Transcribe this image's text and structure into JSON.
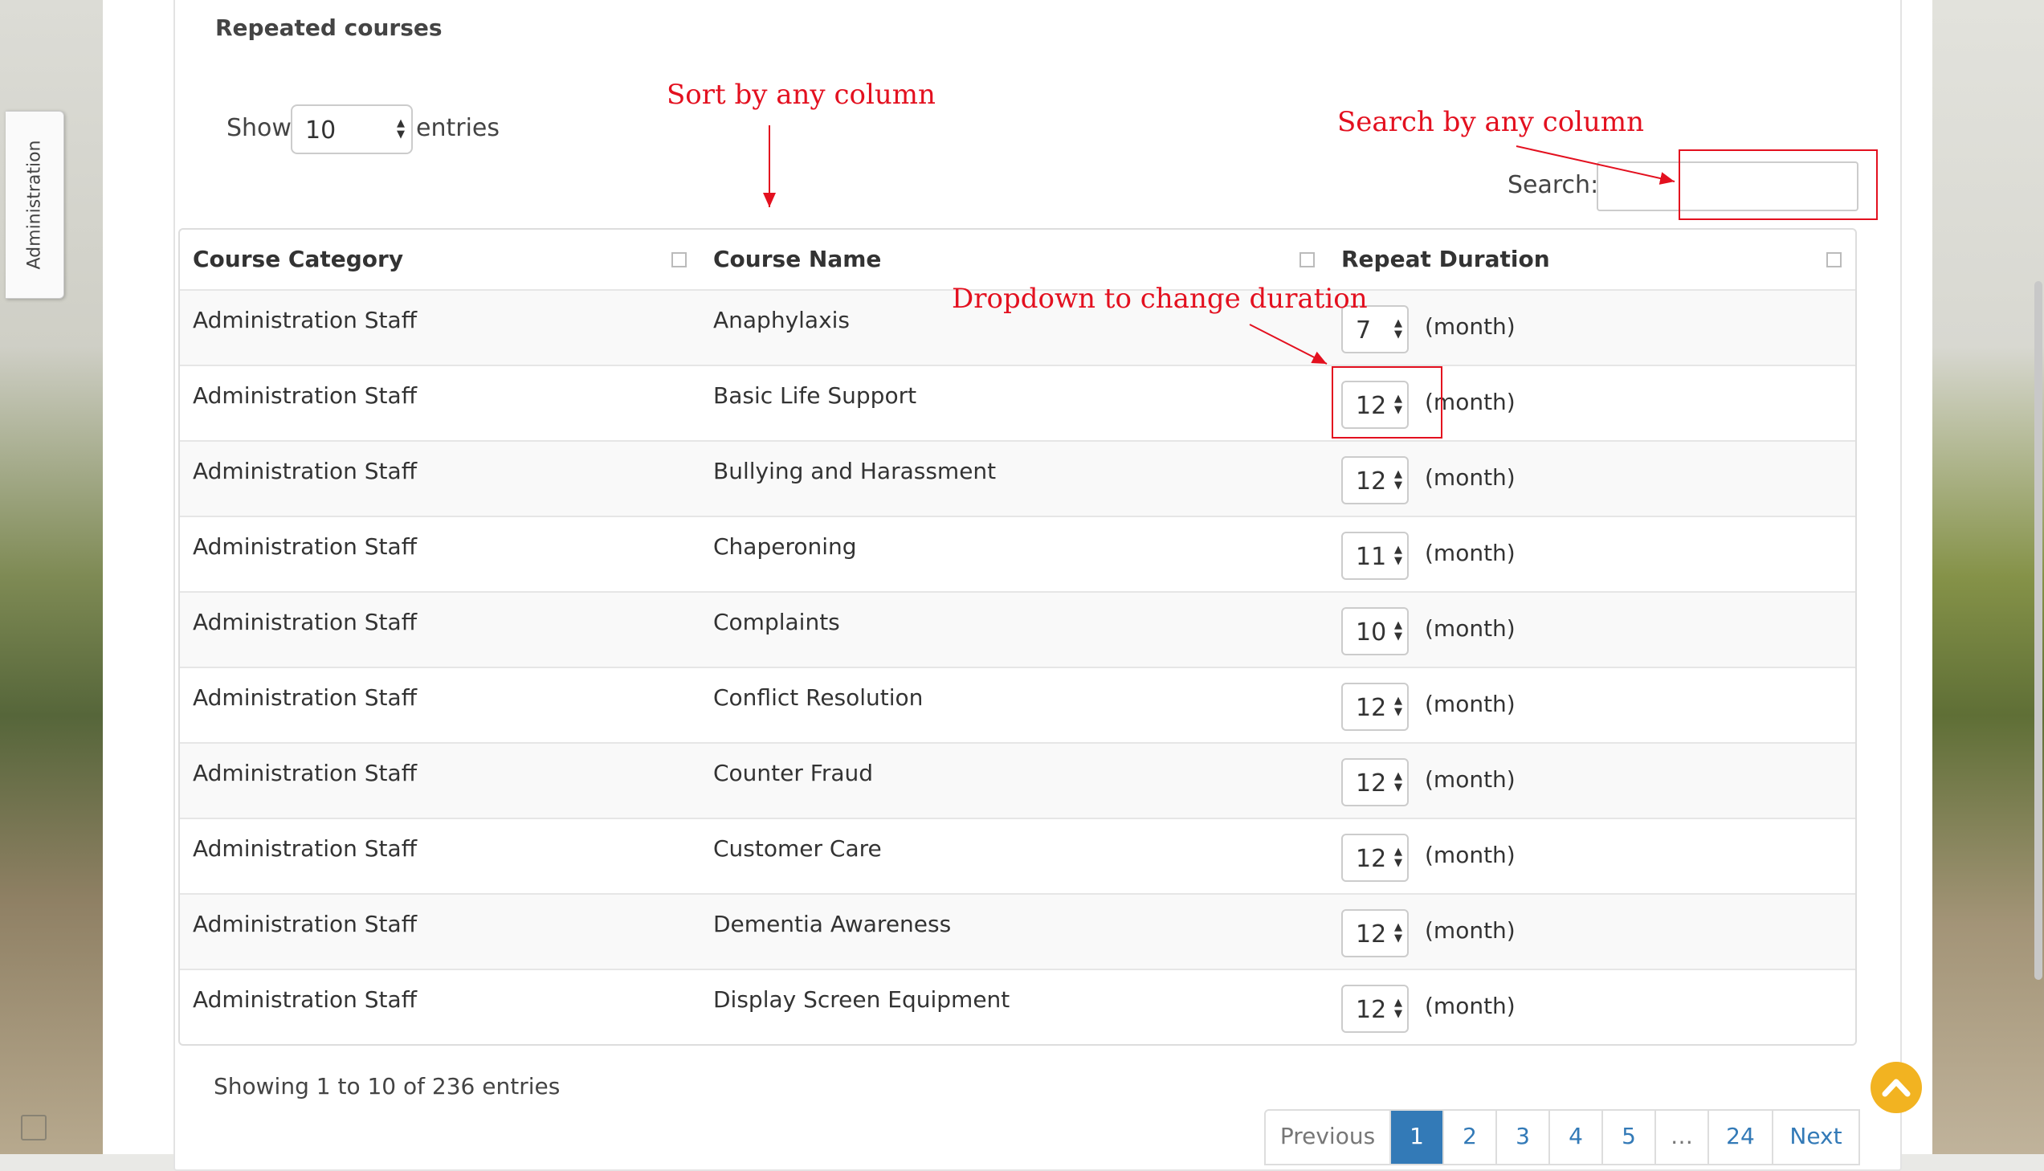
{
  "side_tab": {
    "label": "Administration"
  },
  "section_title": "Repeated courses",
  "length": {
    "show_label": "Show",
    "value": "10",
    "entries_label": "entries"
  },
  "search": {
    "label": "Search:",
    "value": ""
  },
  "columns": [
    "Course Category",
    "Course Name",
    "Repeat Duration"
  ],
  "rows": [
    {
      "category": "Administration Staff",
      "name": "Anaphylaxis",
      "duration": "7",
      "unit": "(month)"
    },
    {
      "category": "Administration Staff",
      "name": "Basic Life Support",
      "duration": "12",
      "unit": "(month)"
    },
    {
      "category": "Administration Staff",
      "name": "Bullying and Harassment",
      "duration": "12",
      "unit": "(month)"
    },
    {
      "category": "Administration Staff",
      "name": "Chaperoning",
      "duration": "11",
      "unit": "(month)"
    },
    {
      "category": "Administration Staff",
      "name": "Complaints",
      "duration": "10",
      "unit": "(month)"
    },
    {
      "category": "Administration Staff",
      "name": "Conflict Resolution",
      "duration": "12",
      "unit": "(month)"
    },
    {
      "category": "Administration Staff",
      "name": "Counter Fraud",
      "duration": "12",
      "unit": "(month)"
    },
    {
      "category": "Administration Staff",
      "name": "Customer Care",
      "duration": "12",
      "unit": "(month)"
    },
    {
      "category": "Administration Staff",
      "name": "Dementia Awareness",
      "duration": "12",
      "unit": "(month)"
    },
    {
      "category": "Administration Staff",
      "name": "Display Screen Equipment",
      "duration": "12",
      "unit": "(month)"
    }
  ],
  "info": "Showing 1 to 10 of 236 entries",
  "pagination": {
    "previous": "Previous",
    "pages": [
      "1",
      "2",
      "3",
      "4",
      "5"
    ],
    "ellipsis": "…",
    "last": "24",
    "next": "Next",
    "active": "1"
  },
  "annotations": {
    "sort": "Sort by any column",
    "search": "Search by any column",
    "dropdown": "Dropdown to change duration"
  },
  "colors": {
    "annotation": "#e3101f",
    "accent": "#337ab7",
    "scroll_top": "#f2b321"
  }
}
